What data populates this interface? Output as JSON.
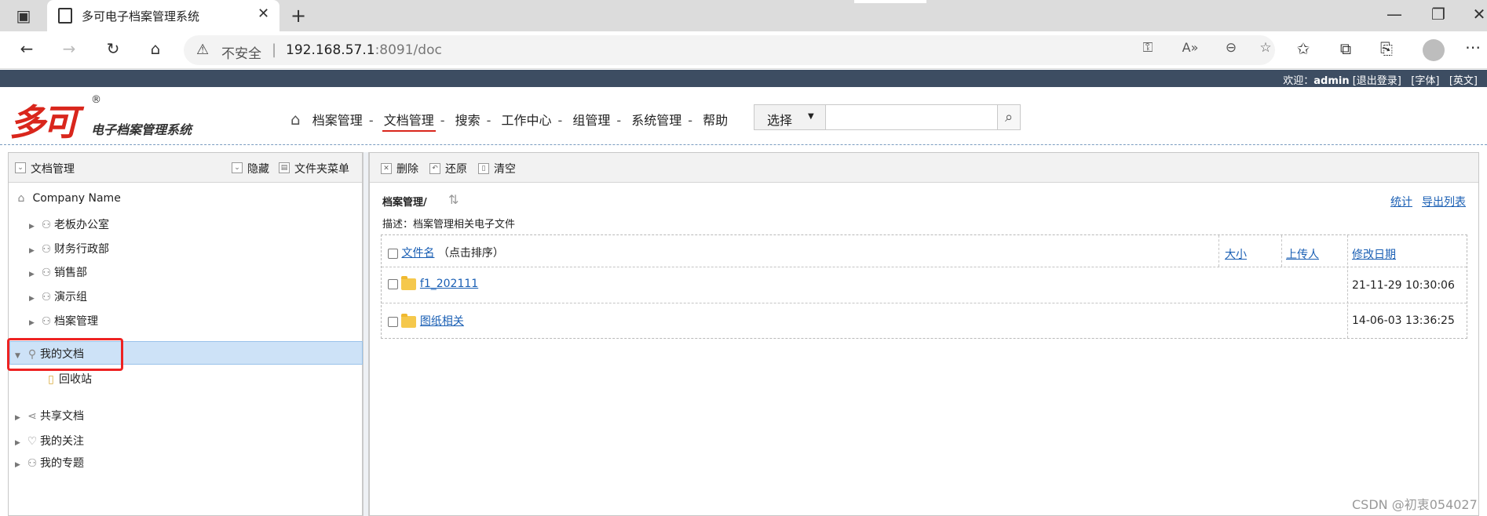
{
  "browser": {
    "tab_title": "多可电子档案管理系统",
    "security_label": "不安全",
    "url_host": "192.168.57.1",
    "url_path": ":8091/doc"
  },
  "topbar": {
    "welcome": "欢迎：",
    "user": "admin",
    "logout": "[退出登录]",
    "font": "[字体]",
    "english": "[英文]"
  },
  "logo": {
    "brand": "多可",
    "registered": "®",
    "subtitle": "电子档案管理系统"
  },
  "nav": {
    "items": [
      "档案管理",
      "文档管理",
      "搜索",
      "工作中心",
      "组管理",
      "系统管理",
      "帮助"
    ],
    "active": "文档管理"
  },
  "search": {
    "select_label": "选择",
    "placeholder": ""
  },
  "left_panel": {
    "title": "文档管理",
    "hide": "隐藏",
    "folder_menu": "文件夹菜单",
    "root": "Company Name",
    "departments": [
      "老板办公室",
      "财务行政部",
      "销售部",
      "演示组",
      "档案管理"
    ],
    "my_docs": "我的文档",
    "recycle": "回收站",
    "shared": "共享文档",
    "favorites": "我的关注",
    "topics": "我的专题"
  },
  "right_panel": {
    "toolbar": {
      "delete": "删除",
      "restore": "还原",
      "clear": "清空"
    },
    "breadcrumb": "档案管理/",
    "stats": "统计",
    "export": "导出列表",
    "description": "描述：档案管理相关电子文件",
    "columns": {
      "name": "文件名",
      "sort_hint": "（点击排序）",
      "size": "大小",
      "uploader": "上传人",
      "modified": "修改日期"
    },
    "rows": [
      {
        "name": "f1_202111",
        "modified": "21-11-29 10:30:06"
      },
      {
        "name": "图纸相关",
        "modified": "14-06-03 13:36:25"
      }
    ]
  },
  "watermark": "CSDN @初衷054027"
}
